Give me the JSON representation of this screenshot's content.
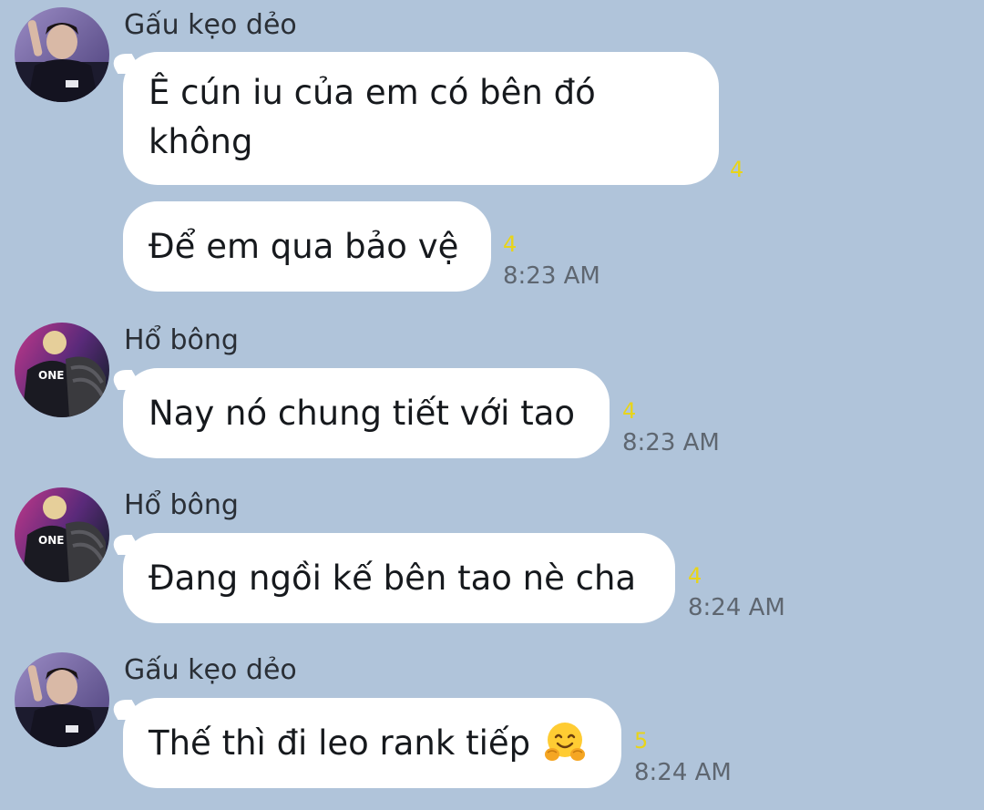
{
  "colors": {
    "background": "#b0c4da",
    "bubble": "#ffffff",
    "read_count": "#e8d419",
    "timestamp": "#5e6670"
  },
  "messages": [
    {
      "sender": "Gấu kẹo dẻo",
      "avatar_icon": "avatar-gau-keo-deo",
      "text_lines": [
        "Ê cún iu của em có bên đó",
        "không"
      ],
      "read_count": "4",
      "time": ""
    },
    {
      "sender": "",
      "text": "Để em qua bảo vệ",
      "read_count": "4",
      "time": "8:23 AM"
    },
    {
      "sender": "Hổ bông",
      "avatar_icon": "avatar-ho-bong",
      "text": "Nay nó chung tiết với tao",
      "read_count": "4",
      "time": "8:23 AM"
    },
    {
      "sender": "Hổ bông",
      "avatar_icon": "avatar-ho-bong",
      "text": "Đang ngồi kế bên tao nè cha",
      "read_count": "4",
      "time": "8:24 AM"
    },
    {
      "sender": "Gấu kẹo dẻo",
      "avatar_icon": "avatar-gau-keo-deo",
      "text": "Thế thì đi leo rank tiếp",
      "emoji_icon": "hugging-face-emoji",
      "read_count": "5",
      "time": "8:24 AM"
    }
  ]
}
